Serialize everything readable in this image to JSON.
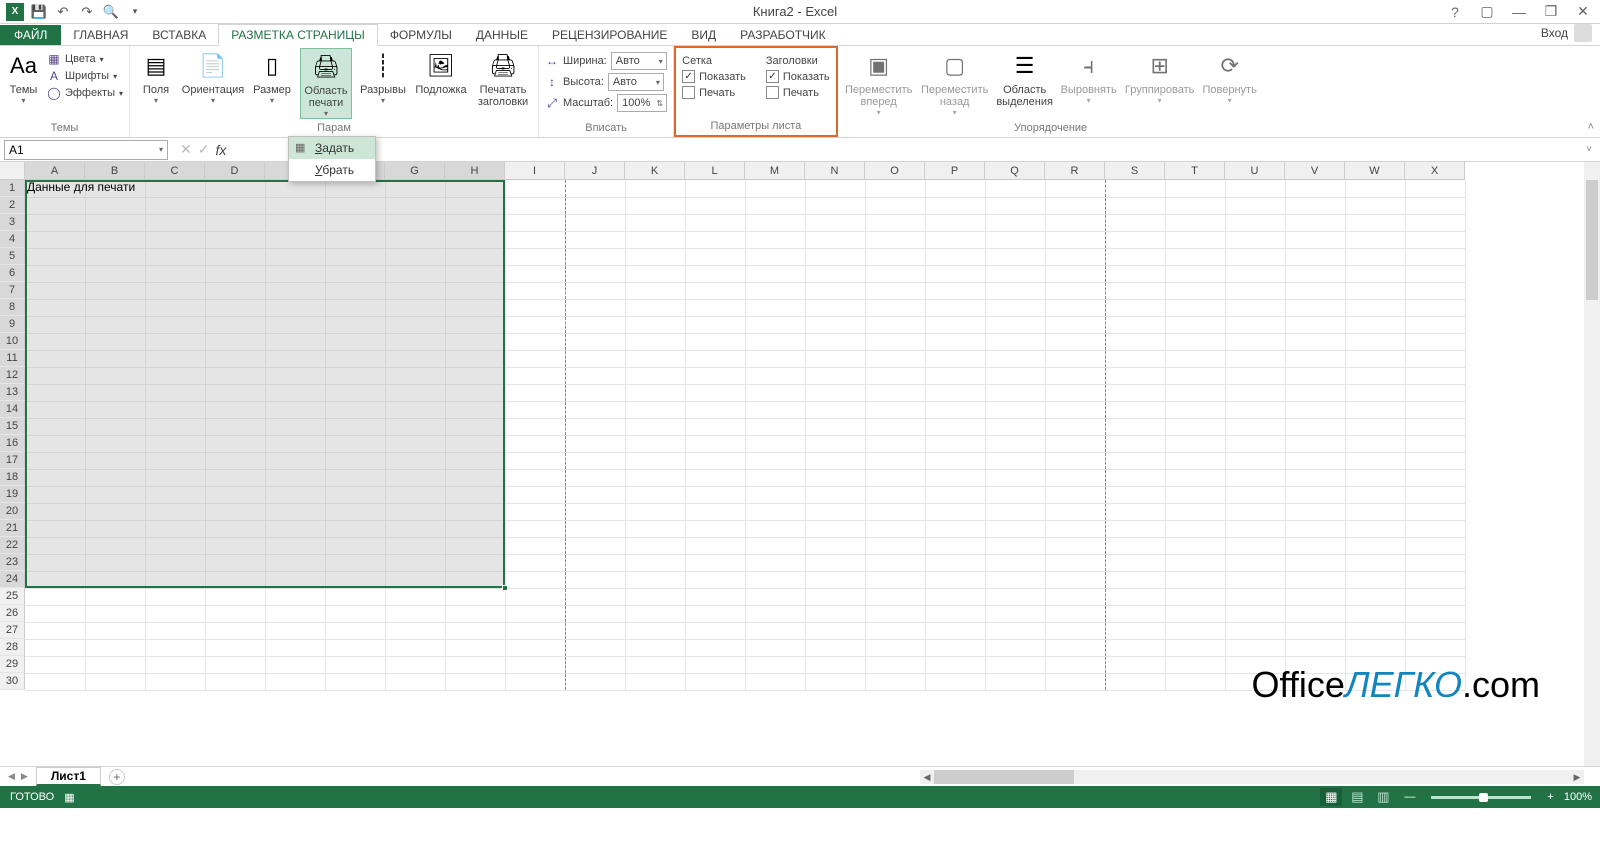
{
  "titlebar": {
    "title": "Книга2 - Excel",
    "help_icon": "?"
  },
  "tabs": {
    "file": "ФАЙЛ",
    "items": [
      "ГЛАВНАЯ",
      "ВСТАВКА",
      "РАЗМЕТКА СТРАНИЦЫ",
      "ФОРМУЛЫ",
      "ДАННЫЕ",
      "РЕЦЕНЗИРОВАНИЕ",
      "ВИД",
      "РАЗРАБОТЧИК"
    ],
    "active_index": 2,
    "login": "Вход"
  },
  "ribbon": {
    "themes": {
      "themes_btn": "Темы",
      "colors": "Цвета",
      "fonts": "Шрифты",
      "effects": "Эффекты",
      "group_label": "Темы"
    },
    "page_setup": {
      "margins": "Поля",
      "orientation": "Ориентация",
      "size": "Размер",
      "print_area": "Область печати",
      "breaks": "Разрывы",
      "background": "Подложка",
      "print_titles": "Печатать заголовки",
      "group_label": "Парам",
      "dropdown": {
        "set": "Задать",
        "clear": "Убрать"
      }
    },
    "scale": {
      "width_label": "Ширина:",
      "width_value": "Авто",
      "height_label": "Высота:",
      "height_value": "Авто",
      "scale_label": "Масштаб:",
      "scale_value": "100%",
      "group_label": "Вписать"
    },
    "sheet_options": {
      "grid_header": "Сетка",
      "headings_header": "Заголовки",
      "show": "Показать",
      "print": "Печать",
      "group_label": "Параметры листа",
      "grid_show_checked": true,
      "grid_print_checked": false,
      "head_show_checked": true,
      "head_print_checked": false
    },
    "arrange": {
      "bring_forward": "Переместить вперед",
      "send_backward": "Переместить назад",
      "selection_pane": "Область выделения",
      "align": "Выровнять",
      "group": "Группировать",
      "rotate": "Повернуть",
      "group_label": "Упорядочение"
    }
  },
  "formula_bar": {
    "name_box": "A1",
    "content_suffix": "для печати"
  },
  "grid": {
    "columns": [
      "A",
      "B",
      "C",
      "D",
      "E",
      "F",
      "G",
      "H",
      "I",
      "J",
      "K",
      "L",
      "M",
      "N",
      "O",
      "P",
      "Q",
      "R",
      "S",
      "T",
      "U",
      "V",
      "W",
      "X"
    ],
    "selected_cols": 8,
    "rows": 30,
    "selected_rows": 24,
    "a1_text": "Данные для печати",
    "page_break_cols": [
      9,
      18
    ]
  },
  "sheets": {
    "active": "Лист1"
  },
  "statusbar": {
    "ready": "ГОТОВО",
    "zoom": "100%"
  },
  "watermark": {
    "part1": "Office",
    "part2": "ЛЕГКО",
    "part3": ".com"
  }
}
